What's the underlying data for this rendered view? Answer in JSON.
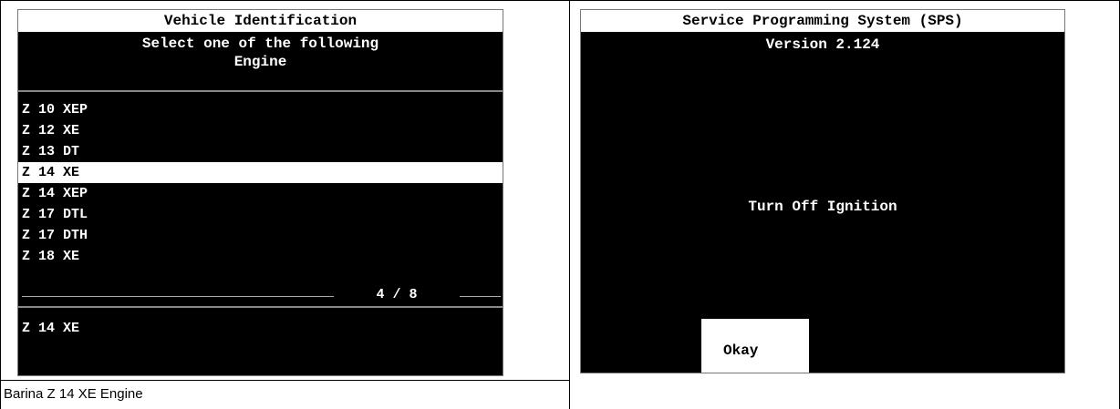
{
  "left_screen": {
    "title": "Vehicle Identification",
    "prompt_line1": "Select one of the following",
    "prompt_line2": "Engine",
    "engines": [
      "Z 10 XEP",
      "Z 12 XE",
      "Z 13 DT",
      "Z 14 XE",
      "Z 14 XEP",
      "Z 17 DTL",
      "Z 17 DTH",
      "Z 18 XE"
    ],
    "selected_index": 3,
    "counter": "4 / 8",
    "current_selection": "Z 14 XE"
  },
  "caption": "Barina Z 14 XE Engine",
  "right_screen": {
    "title": "Service Programming System (SPS)",
    "version": "Version 2.124",
    "message": "Turn Off Ignition",
    "okay_label": "Okay"
  },
  "colors": {
    "screen_bg": "#000000",
    "screen_text": "#ffffff",
    "highlight_bg": "#ffffff",
    "highlight_text": "#000000"
  }
}
